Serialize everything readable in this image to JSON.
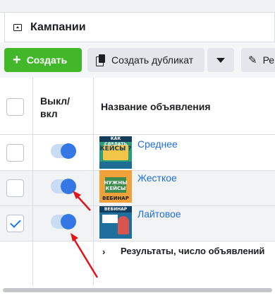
{
  "campaign_tab": {
    "title": "Кампании",
    "icon": "folder-icon"
  },
  "toolbar": {
    "create_label": "Создать",
    "duplicate_label": "Создать дубликат",
    "edit_label": "Ре"
  },
  "table": {
    "header_toggle": "Выкл/\nвкл",
    "header_name": "Название объявления",
    "rows": [
      {
        "name": "Среднее",
        "selected": false,
        "enabled": true,
        "thumb_text": "КАК СДЕЛАТЬ КЕЙСЫ ? ЕСЛИ ТЫ ПРОДАКТ МЕНЕДЖЕР"
      },
      {
        "name": "Жесткое",
        "selected": false,
        "enabled": true,
        "thumb_text": "НУЖНЫ КЕЙСЫ ВЕБИНАР"
      },
      {
        "name": "Лайтовое",
        "selected": true,
        "enabled": true,
        "thumb_text": "ВЕБИНАР Для продакт менеджеров"
      }
    ],
    "results_label": "Результаты, число объявлений"
  },
  "colors": {
    "create_button": "#42b72a",
    "toggle_knob": "#3578e5",
    "link": "#216fdb",
    "annotation_arrow": "#e0141b"
  }
}
